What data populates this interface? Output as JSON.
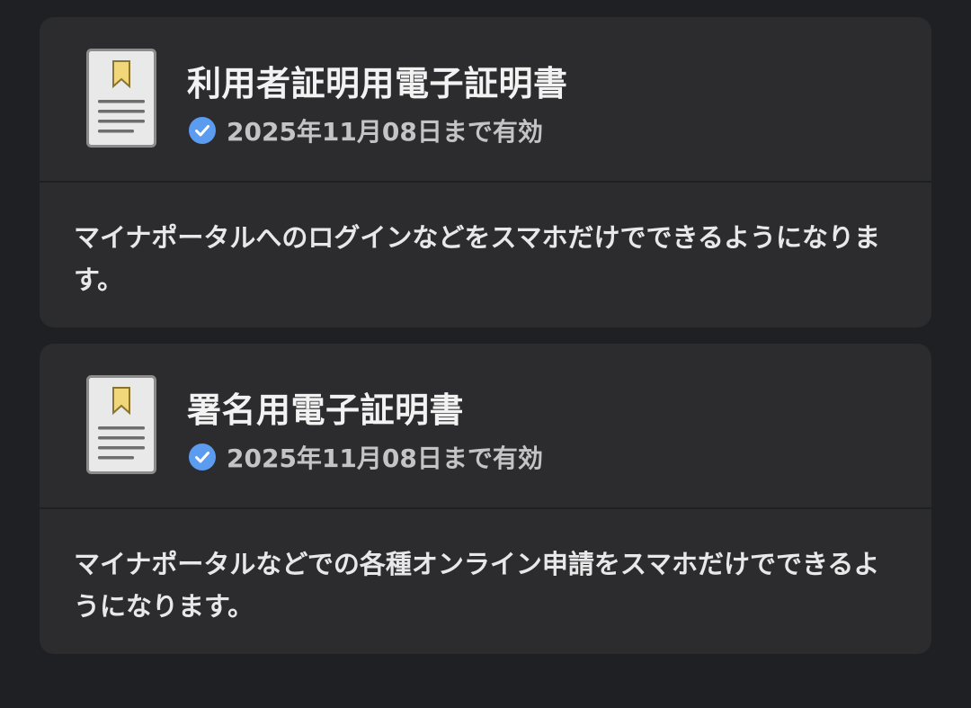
{
  "certificates": [
    {
      "title": "利用者証明用電子証明書",
      "validity": "2025年11月08日まで有効",
      "description": "マイナポータルへのログインなどをスマホだけでできるようになります。"
    },
    {
      "title": "署名用電子証明書",
      "validity": "2025年11月08日まで有効",
      "description": "マイナポータルなどでの各種オンライン申請をスマホだけでできるようになります。"
    }
  ],
  "icons": {
    "document": "certificate-document-icon",
    "check": "check-circle-icon"
  },
  "colors": {
    "background": "#1f2023",
    "card": "#2c2c2e",
    "check": "#5b9cf0",
    "bookmark": "#f2d77a"
  }
}
